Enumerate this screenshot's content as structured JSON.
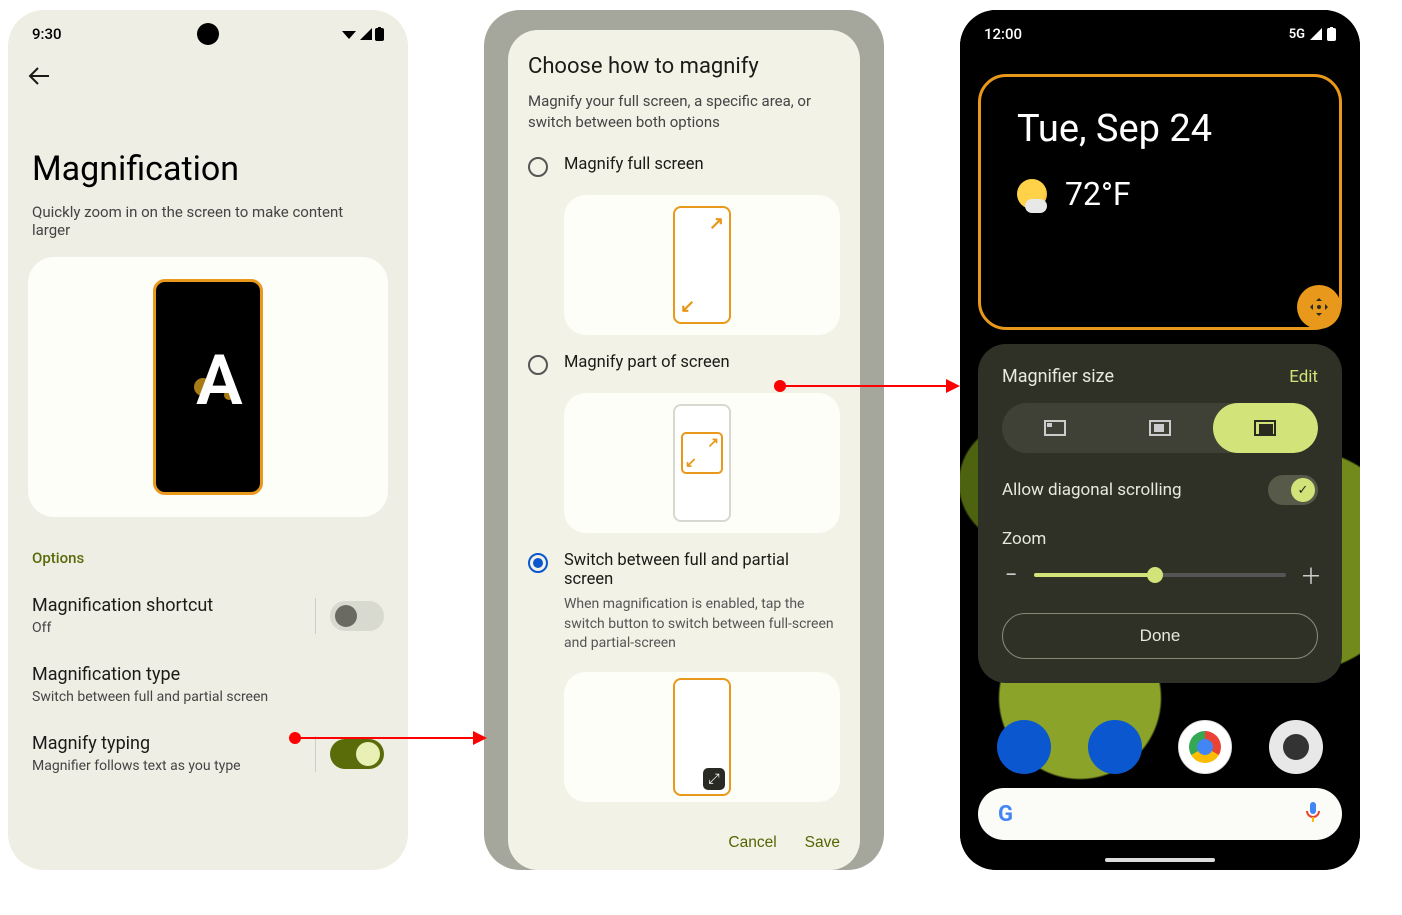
{
  "phone1": {
    "statusbar": {
      "time": "9:30"
    },
    "title": "Magnification",
    "subtitle": "Quickly zoom in on the screen to make content larger",
    "options_header": "Options",
    "rows": {
      "shortcut": {
        "label": "Magnification shortcut",
        "sub": "Off",
        "toggle": false
      },
      "type": {
        "label": "Magnification type",
        "sub": "Switch between full and partial screen"
      },
      "typing": {
        "label": "Magnify typing",
        "sub": "Magnifier follows text as you type",
        "toggle": true
      }
    }
  },
  "phone2": {
    "title": "Choose how to magnify",
    "subtitle": "Magnify your full screen, a specific area, or switch between both options",
    "opt_full": "Magnify full screen",
    "opt_part": "Magnify part of screen",
    "opt_switch": "Switch between full and partial screen",
    "opt_switch_desc": "When magnification is enabled, tap the switch button to switch between full-screen and partial-screen",
    "selected": "switch",
    "actions": {
      "cancel": "Cancel",
      "save": "Save"
    }
  },
  "phone3": {
    "statusbar": {
      "time": "12:00",
      "network": "5G"
    },
    "widget": {
      "date": "Tue, Sep 24",
      "temp": "72°F"
    },
    "panel": {
      "title": "Magnifier size",
      "edit": "Edit",
      "diag_label": "Allow diagonal scrolling",
      "diag_on": true,
      "zoom_label": "Zoom",
      "zoom_pct": 48,
      "done": "Done"
    }
  }
}
